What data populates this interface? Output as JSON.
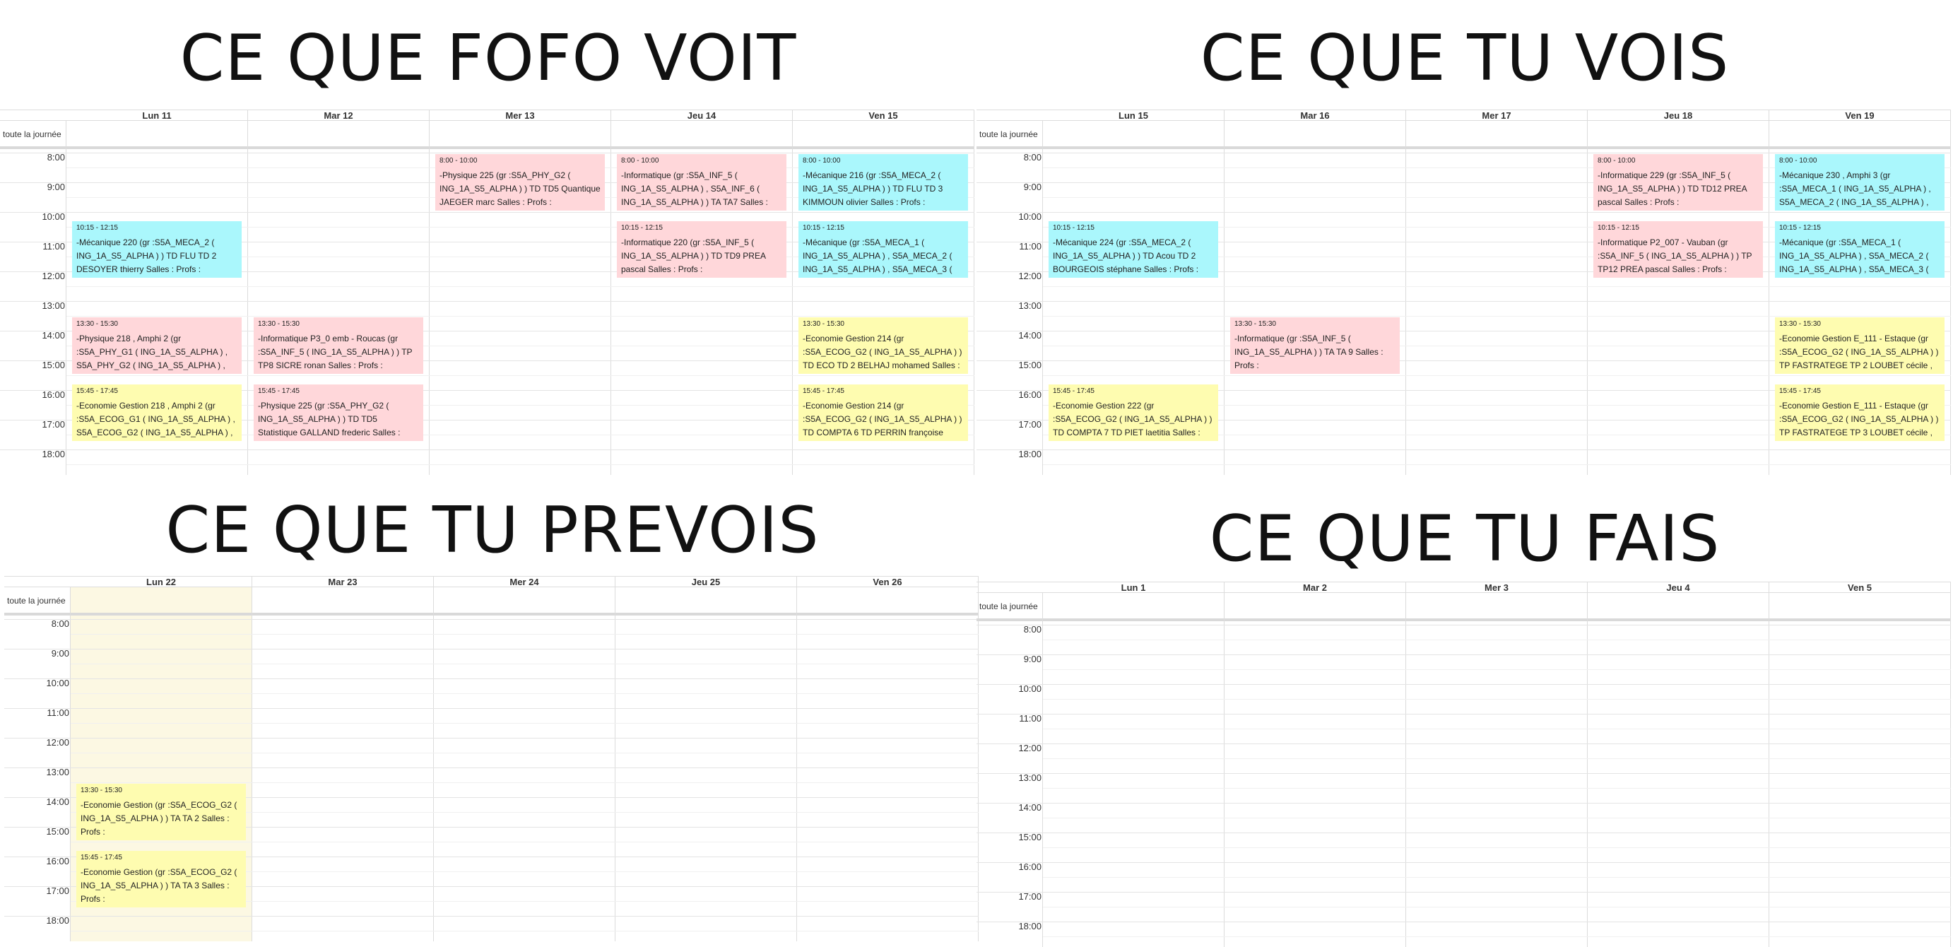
{
  "panels": [
    {
      "title": "CE QUE FOFO VOIT",
      "allday_label": "toute la journée",
      "days": [
        "Lun 11",
        "Mar 12",
        "Mer 13",
        "Jeu 14",
        "Ven 15"
      ],
      "hours": [
        "8:00",
        "9:00",
        "10:00",
        "11:00",
        "12:00",
        "13:00",
        "14:00",
        "15:00",
        "16:00",
        "17:00",
        "18:00"
      ],
      "events": [
        {
          "day": 0,
          "time": "10:15 - 12:15",
          "desc": "-Mécanique 220 (gr :S5A_MECA_2 ( ING_1A_S5_ALPHA ) ) TD FLU TD 2 DESOYER thierry Salles : Profs :",
          "color": "cyan"
        },
        {
          "day": 0,
          "time": "13:30 - 15:30",
          "desc": "-Physique 218 , Amphi 2 (gr :S5A_PHY_G1 ( ING_1A_S5_ALPHA ) , S5A_PHY_G2 ( ING_1A_S5_ALPHA ) ,",
          "color": "pink"
        },
        {
          "day": 0,
          "time": "15:45 - 17:45",
          "desc": "-Economie Gestion 218 , Amphi 2 (gr :S5A_ECOG_G1 ( ING_1A_S5_ALPHA ) , S5A_ECOG_G2 ( ING_1A_S5_ALPHA ) ,",
          "color": "yellow"
        },
        {
          "day": 1,
          "time": "13:30 - 15:30",
          "desc": "-Informatique P3_0 emb - Roucas (gr :S5A_INF_5 ( ING_1A_S5_ALPHA ) ) TP TP8 SICRE ronan Salles : Profs :",
          "color": "pink"
        },
        {
          "day": 1,
          "time": "15:45 - 17:45",
          "desc": "-Physique 225 (gr :S5A_PHY_G2 ( ING_1A_S5_ALPHA ) ) TD TD5 Statistique GALLAND frederic Salles :",
          "color": "pink"
        },
        {
          "day": 2,
          "time": "8:00 - 10:00",
          "desc": "-Physique 225 (gr :S5A_PHY_G2 ( ING_1A_S5_ALPHA ) ) TD TD5 Quantique JAEGER marc Salles : Profs :",
          "color": "pink"
        },
        {
          "day": 3,
          "time": "8:00 - 10:00",
          "desc": "-Informatique (gr :S5A_INF_5 ( ING_1A_S5_ALPHA ) , S5A_INF_6 ( ING_1A_S5_ALPHA ) ) TA TA7 Salles :",
          "color": "pink"
        },
        {
          "day": 3,
          "time": "10:15 - 12:15",
          "desc": "-Informatique 220 (gr :S5A_INF_5 ( ING_1A_S5_ALPHA ) ) TD TD9 PREA pascal Salles : Profs :",
          "color": "pink"
        },
        {
          "day": 4,
          "time": "8:00 - 10:00",
          "desc": "-Mécanique 216 (gr :S5A_MECA_2 ( ING_1A_S5_ALPHA ) ) TD FLU TD 3 KIMMOUN olivier Salles : Profs :",
          "color": "cyan"
        },
        {
          "day": 4,
          "time": "10:15 - 12:15",
          "desc": "-Mécanique (gr :S5A_MECA_1 ( ING_1A_S5_ALPHA ) , S5A_MECA_2 ( ING_1A_S5_ALPHA ) , S5A_MECA_3 (",
          "color": "cyan"
        },
        {
          "day": 4,
          "time": "13:30 - 15:30",
          "desc": "-Economie Gestion 214 (gr :S5A_ECOG_G2 ( ING_1A_S5_ALPHA ) ) TD ECO TD 2 BELHAJ mohamed Salles :",
          "color": "yellow"
        },
        {
          "day": 4,
          "time": "15:45 - 17:45",
          "desc": "-Economie Gestion 214 (gr :S5A_ECOG_G2 ( ING_1A_S5_ALPHA ) ) TD COMPTA 6 TD PERRIN françoise",
          "color": "yellow"
        }
      ]
    },
    {
      "title": "CE QUE TU VOIS",
      "allday_label": "toute la journée",
      "days": [
        "Lun 15",
        "Mar 16",
        "Mer 17",
        "Jeu 18",
        "Ven 19"
      ],
      "hours": [
        "8:00",
        "9:00",
        "10:00",
        "11:00",
        "12:00",
        "13:00",
        "14:00",
        "15:00",
        "16:00",
        "17:00",
        "18:00"
      ],
      "events": [
        {
          "day": 0,
          "time": "10:15 - 12:15",
          "desc": "-Mécanique 224 (gr :S5A_MECA_2 ( ING_1A_S5_ALPHA ) ) TD Acou TD 2 BOURGEOIS stéphane Salles : Profs :",
          "color": "cyan"
        },
        {
          "day": 0,
          "time": "15:45 - 17:45",
          "desc": "-Economie Gestion 222 (gr :S5A_ECOG_G2 ( ING_1A_S5_ALPHA ) ) TD COMPTA 7 TD PIET laetitia Salles :",
          "color": "yellow"
        },
        {
          "day": 1,
          "time": "13:30 - 15:30",
          "desc": "-Informatique (gr :S5A_INF_5 ( ING_1A_S5_ALPHA ) ) TA TA 9 Salles : Profs :",
          "color": "pink"
        },
        {
          "day": 3,
          "time": "8:00 - 10:00",
          "desc": "-Informatique 229 (gr :S5A_INF_5 ( ING_1A_S5_ALPHA ) ) TD TD12 PREA pascal Salles : Profs :",
          "color": "pink"
        },
        {
          "day": 3,
          "time": "10:15 - 12:15",
          "desc": "-Informatique P2_007 - Vauban (gr :S5A_INF_5 ( ING_1A_S5_ALPHA ) ) TP TP12 PREA pascal Salles : Profs :",
          "color": "pink"
        },
        {
          "day": 4,
          "time": "8:00 - 10:00",
          "desc": "-Mécanique 230 , Amphi 3 (gr :S5A_MECA_1 ( ING_1A_S5_ALPHA ) , S5A_MECA_2 ( ING_1A_S5_ALPHA ) ,",
          "color": "cyan"
        },
        {
          "day": 4,
          "time": "10:15 - 12:15",
          "desc": "-Mécanique (gr :S5A_MECA_1 ( ING_1A_S5_ALPHA ) , S5A_MECA_2 ( ING_1A_S5_ALPHA ) , S5A_MECA_3 (",
          "color": "cyan"
        },
        {
          "day": 4,
          "time": "13:30 - 15:30",
          "desc": "-Economie Gestion E_111 - Estaque (gr :S5A_ECOG_G2 ( ING_1A_S5_ALPHA ) ) TP FASTRATEGE TP 2 LOUBET cécile ,",
          "color": "yellow"
        },
        {
          "day": 4,
          "time": "15:45 - 17:45",
          "desc": "-Economie Gestion E_111 - Estaque (gr :S5A_ECOG_G2 ( ING_1A_S5_ALPHA ) ) TP FASTRATEGE TP 3 LOUBET cécile ,",
          "color": "yellow"
        }
      ]
    },
    {
      "title": "CE QUE TU PREVOIS",
      "allday_label": "toute la journée",
      "days": [
        "Lun 22",
        "Mar 23",
        "Mer 24",
        "Jeu 25",
        "Ven 26"
      ],
      "hours": [
        "8:00",
        "9:00",
        "10:00",
        "11:00",
        "12:00",
        "13:00",
        "14:00",
        "15:00",
        "16:00",
        "17:00",
        "18:00"
      ],
      "today_col": 0,
      "events": [
        {
          "day": 0,
          "time": "13:30 - 15:30",
          "desc": "-Economie Gestion (gr :S5A_ECOG_G2 ( ING_1A_S5_ALPHA ) ) TA TA 2 Salles : Profs :",
          "color": "yellow"
        },
        {
          "day": 0,
          "time": "15:45 - 17:45",
          "desc": "-Economie Gestion (gr :S5A_ECOG_G2 ( ING_1A_S5_ALPHA ) ) TA TA 3 Salles : Profs :",
          "color": "yellow"
        }
      ]
    },
    {
      "title": "CE QUE TU FAIS",
      "allday_label": "toute la journée",
      "days": [
        "Lun 1",
        "Mar 2",
        "Mer 3",
        "Jeu 4",
        "Ven 5"
      ],
      "hours": [
        "8:00",
        "9:00",
        "10:00",
        "11:00",
        "12:00",
        "13:00",
        "14:00",
        "15:00",
        "16:00",
        "17:00",
        "18:00"
      ],
      "events": []
    }
  ]
}
